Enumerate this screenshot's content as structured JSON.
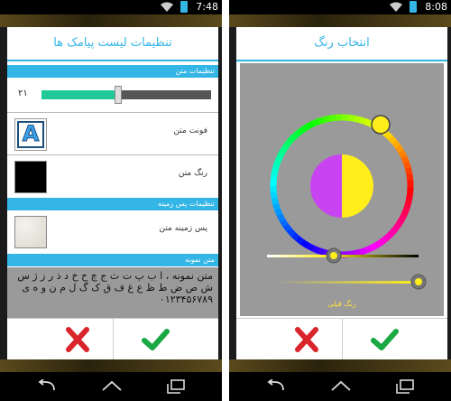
{
  "left": {
    "statusbar": {
      "time": "7:48"
    },
    "dialog": {
      "title": "تنظیمات لیست پیامک ها",
      "text_settings_header": "تنظیمات متن",
      "slider": {
        "value_label": "۲۱",
        "fraction": 0.45
      },
      "font_label": "فونت متن",
      "color_label": "رنگ متن",
      "bg_settings_header": "تنظیمات پس زمینه",
      "bg_label": "پس زمینه متن",
      "sample_header": "متن نمونه",
      "sample_text": [
        "متن نمونه ، ا ب پ ت ث ج چ ح خ د ذ ر ز ژ س",
        "ش ص ض ط ظ ع غ ف ق ک گ ل م ن و ه ی",
        "۰۱۲۳۴۵۶۷۸۹"
      ],
      "cancel_icon": "cancel-x-icon",
      "confirm_icon": "confirm-check-icon"
    }
  },
  "right": {
    "statusbar": {
      "time": "8:08"
    },
    "dialog": {
      "title": "انتخاب رنگ",
      "color_name": "رنگ قبلی",
      "colors": {
        "old": "#c844f0",
        "new": "#ffee1a",
        "accent": "#33b5e5"
      }
    }
  },
  "navigation": [
    "back-icon",
    "home-icon",
    "recent-apps-icon"
  ]
}
